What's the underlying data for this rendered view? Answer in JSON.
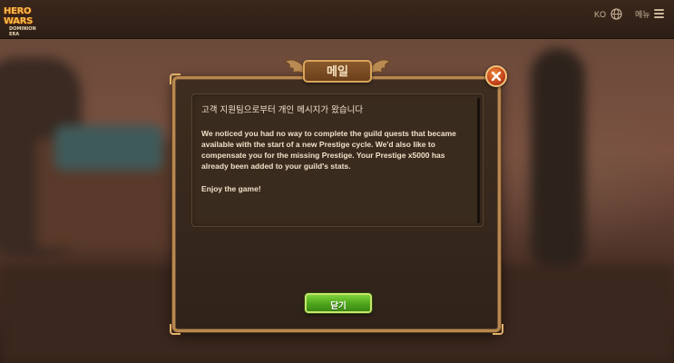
{
  "header": {
    "logo_main": "HERO WARS",
    "logo_sub": "DOMINION ERA",
    "language_code": "KO",
    "language_icon": "globe-icon",
    "menu_label": "메뉴",
    "menu_icon": "hamburger-icon"
  },
  "dialog": {
    "title": "메일",
    "close_icon": "close-icon",
    "subject": "고객 지원팀으로부터 개인 메시지가 왔습니다",
    "body": "We noticed you had no way to complete the guild quests that became available with the start of a new Prestige cycle. We'd also like to compensate you for the missing Prestige. Your Prestige x5000 has already been added to your guild's stats.",
    "closing": "Enjoy the game!",
    "confirm_label": "닫기"
  },
  "colors": {
    "frame_gold": "#b9884f",
    "panel_bg": "#3a2b1f",
    "confirm_green": "#4ea51c",
    "close_red": "#c2421a",
    "text_cream": "#efe2c8"
  }
}
